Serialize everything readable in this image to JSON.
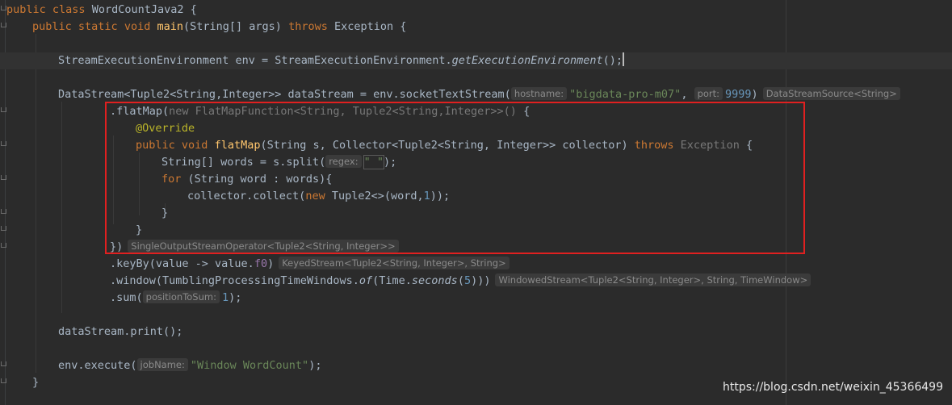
{
  "code": {
    "l1": {
      "k1": "public",
      "k2": "class",
      "t": " WordCountJava2 {"
    },
    "l2": {
      "k1": "public",
      "k2": "static",
      "k3": "void",
      "fn": "main",
      "t1": "(String[] args) ",
      "k4": "throws",
      "t2": " Exception {"
    },
    "l4": {
      "t1": "StreamExecutionEnvironment env = StreamExecutionEnvironment.",
      "m": "getExecutionEnvironment",
      "t2": "();"
    },
    "l6": {
      "t1": "DataStream<Tuple2<String,Integer>> dataStream = env.socketTextStream(",
      "h1": "hostname:",
      "s1": "\"bigdata-pro-m07\"",
      "c": ", ",
      "h2": "port:",
      "n": "9999",
      "t2": ")",
      "h3": "DataStreamSource<String>"
    },
    "l7": {
      "t1": ".flatMap(",
      "g": "new FlatMapFunction<String, Tuple2<String,Integer>>() ",
      "t2": "{"
    },
    "l8": {
      "a": "@Override"
    },
    "l9": {
      "k1": "public",
      "k2": "void",
      "fn": "flatMap",
      "t1": "(String s, Collector<Tuple2<String, Integer>> collector) ",
      "k3": "throws",
      "g": " Exception",
      "t2": " {"
    },
    "l10": {
      "t1": "String[] words = s.split(",
      "h": "regex:",
      "s": "\" \"",
      "t2": ");"
    },
    "l11": {
      "k": "for",
      "t": " (String word : words){"
    },
    "l12": {
      "t1": "collector.collect(",
      "k": "new",
      "t2": " Tuple2<>(word,",
      "n": "1",
      "t3": "));"
    },
    "l13": {
      "t": "}"
    },
    "l14": {
      "t": "}"
    },
    "l15": {
      "t": "})",
      "h": "SingleOutputStreamOperator<Tuple2<String, Integer>>"
    },
    "l16": {
      "t1": ".keyBy(value -> value.",
      "f": "f0",
      "t2": ")",
      "h": "KeyedStream<Tuple2<String, Integer>, String>"
    },
    "l17": {
      "t1": ".window(TumblingProcessingTimeWindows.",
      "m1": "of",
      "t2": "(Time.",
      "m2": "seconds",
      "t3": "(",
      "n": "5",
      "t4": ")))",
      "h": "WindowedStream<Tuple2<String, Integer>, String, TimeWindow>"
    },
    "l18": {
      "t1": ".sum(",
      "h": "positionToSum:",
      "n": "1",
      "t2": ");"
    },
    "l20": {
      "t": "dataStream.print();"
    },
    "l22": {
      "t1": "env.execute(",
      "h": "jobName:",
      "s": "\"Window WordCount\"",
      "t2": ");"
    },
    "l23": {
      "t": "}"
    }
  },
  "watermark": "https://blog.csdn.net/weixin_45366499",
  "colors": {
    "background": "#2b2b2b",
    "keyword": "#cc7832",
    "string": "#6a8759",
    "number": "#6897bb",
    "function": "#ffc66d",
    "annotation": "#bbb529",
    "highlight_box": "#e02020"
  }
}
